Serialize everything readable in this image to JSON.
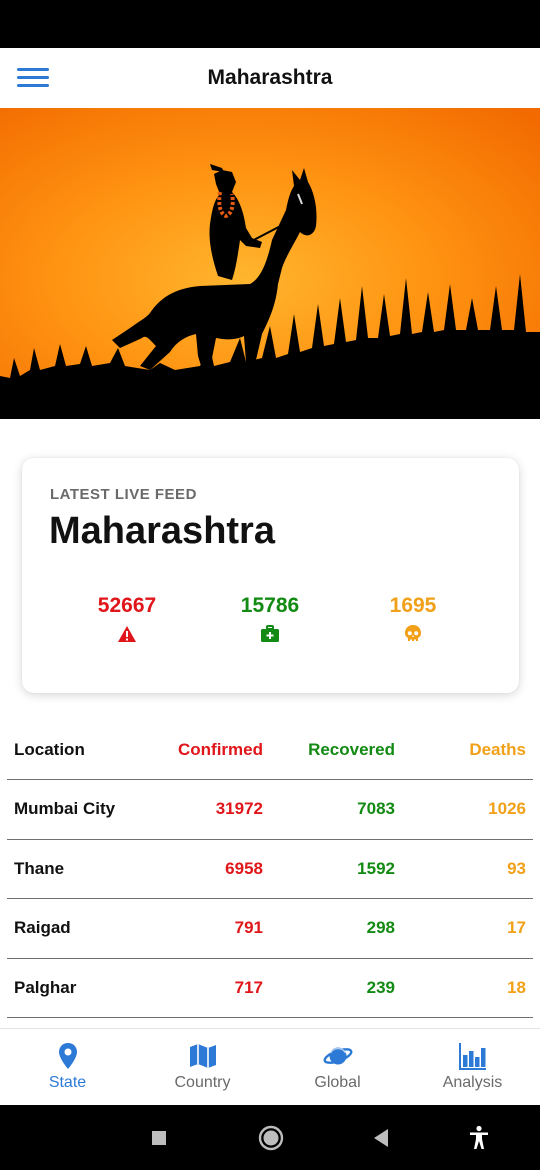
{
  "app_bar": {
    "title": "Maharashtra",
    "menu_icon": "hamburger-menu-icon",
    "accent": "#2d7ad6"
  },
  "hero": {
    "description_icon": "horse-rider-silhouette-image",
    "colors": {
      "sky_top": "#ff7a00",
      "sky_mid": "#ff9d1c",
      "ground": "#000000"
    }
  },
  "feed": {
    "label": "LATEST LIVE FEED",
    "title": "Maharashtra",
    "stats": {
      "confirmed": {
        "value": "52667",
        "icon": "warning-triangle-icon",
        "color": "#e0161a"
      },
      "recovered": {
        "value": "15786",
        "icon": "medical-kit-icon",
        "color": "#138a13"
      },
      "deaths": {
        "value": "1695",
        "icon": "skull-icon",
        "color": "#f1a018"
      }
    }
  },
  "table": {
    "headers": {
      "location": "Location",
      "confirmed": "Confirmed",
      "recovered": "Recovered",
      "deaths": "Deaths"
    },
    "rows": [
      {
        "location": "Mumbai City",
        "confirmed": "31972",
        "recovered": "7083",
        "deaths": "1026"
      },
      {
        "location": "Thane",
        "confirmed": "6958",
        "recovered": "1592",
        "deaths": "93"
      },
      {
        "location": "Raigad",
        "confirmed": "791",
        "recovered": "298",
        "deaths": "17"
      },
      {
        "location": "Palghar",
        "confirmed": "717",
        "recovered": "239",
        "deaths": "18"
      }
    ]
  },
  "bottom_nav": {
    "active": "state",
    "items": [
      {
        "id": "state",
        "label": "State",
        "icon": "map-pin-icon"
      },
      {
        "id": "country",
        "label": "Country",
        "icon": "map-icon"
      },
      {
        "id": "global",
        "label": "Global",
        "icon": "planet-icon"
      },
      {
        "id": "analysis",
        "label": "Analysis",
        "icon": "bar-chart-icon"
      }
    ]
  },
  "system_nav": {
    "icons": [
      "recents-square-icon",
      "home-circle-icon",
      "back-triangle-icon",
      "accessibility-icon"
    ]
  }
}
